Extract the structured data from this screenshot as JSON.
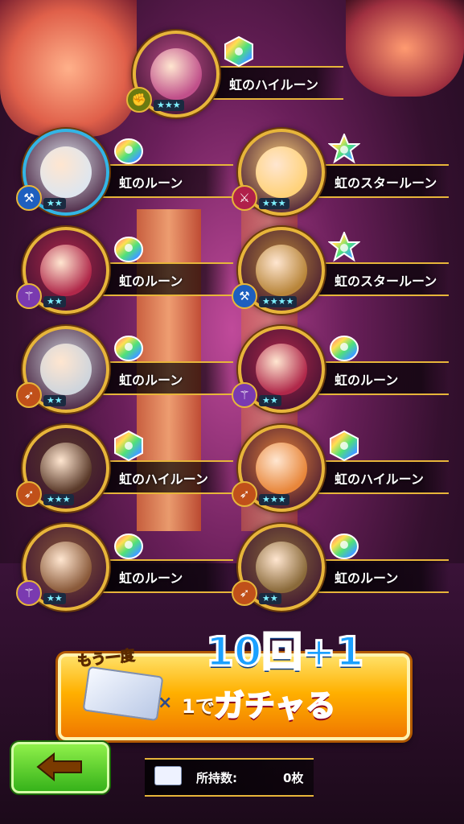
{
  "results": [
    {
      "name": "虹のハイルーン",
      "stars": "★★★",
      "weapon": "fist-icon",
      "rune": "hex",
      "frame": "gold",
      "face": "#c0508a"
    },
    {
      "name": "虹のルーン",
      "stars": "★★",
      "weapon": "axe-icon",
      "rune": "blob",
      "frame": "blue",
      "face": "#dfe6ee"
    },
    {
      "name": "虹のスタールーン",
      "stars": "★★★",
      "weapon": "sword-icon",
      "rune": "star",
      "frame": "gold",
      "face": "#ffd27a"
    },
    {
      "name": "虹のルーン",
      "stars": "★★",
      "weapon": "staff-icon",
      "rune": "blob",
      "frame": "gold",
      "face": "#b0284a"
    },
    {
      "name": "虹のスタールーン",
      "stars": "★★★★",
      "weapon": "axe-icon",
      "rune": "star",
      "frame": "gold",
      "face": "#b8853a"
    },
    {
      "name": "虹のルーン",
      "stars": "★★",
      "weapon": "bow-icon",
      "rune": "blob",
      "frame": "gold",
      "face": "#cfd5dc"
    },
    {
      "name": "虹のルーン",
      "stars": "★★",
      "weapon": "staff-icon",
      "rune": "blob",
      "frame": "gold",
      "face": "#b0284a"
    },
    {
      "name": "虹のハイルーン",
      "stars": "★★★",
      "weapon": "bow-icon",
      "rune": "hex",
      "frame": "gold",
      "face": "#5a3a2a"
    },
    {
      "name": "虹のハイルーン",
      "stars": "★★★",
      "weapon": "bow-icon",
      "rune": "hex",
      "frame": "gold",
      "face": "#e8863a"
    },
    {
      "name": "虹のルーン",
      "stars": "★★",
      "weapon": "staff-icon",
      "rune": "blob",
      "frame": "gold",
      "face": "#8a5a3a"
    },
    {
      "name": "虹のルーン",
      "stars": "★★",
      "weapon": "bow-icon",
      "rune": "blob",
      "frame": "gold",
      "face": "#8a6a3a"
    }
  ],
  "cta": {
    "again": "もう一度",
    "count": "10回+1",
    "one": "1で",
    "main": "ガチャる",
    "times": "×"
  },
  "owned": {
    "label": "所持数:",
    "value": "0枚"
  },
  "colors": {
    "frame_gold": "#e7b53a",
    "frame_blue": "#33b5e5",
    "cta_red": "#ff2d55",
    "back_green": "#36b21a"
  }
}
